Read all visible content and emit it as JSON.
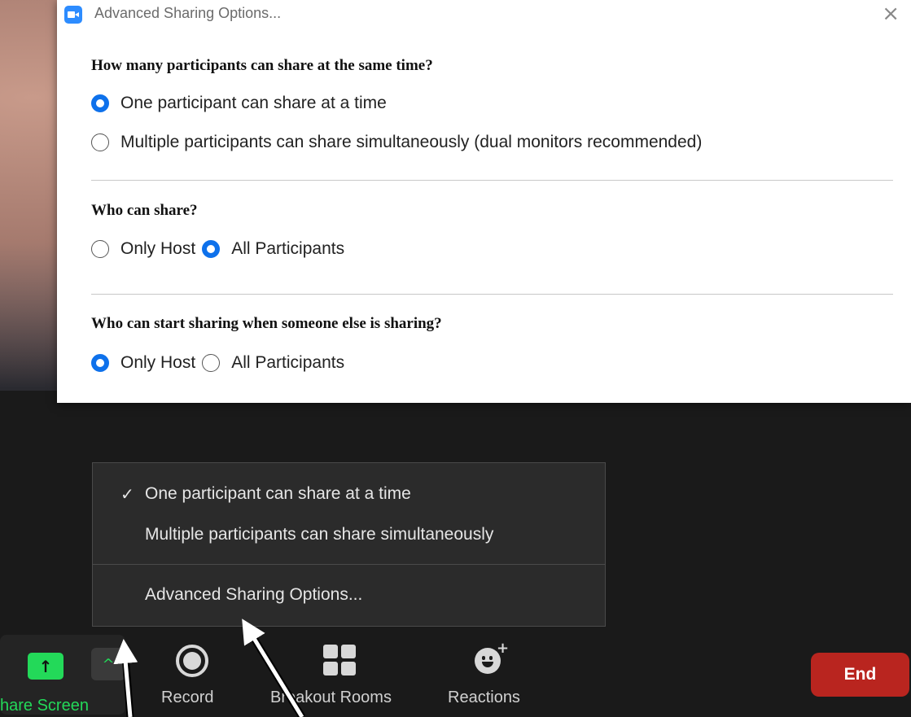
{
  "dialog": {
    "title": "Advanced Sharing Options...",
    "close": "×",
    "section1": {
      "heading": "How many participants can share at the same time?",
      "options": [
        {
          "label": "One participant can share at a time",
          "selected": true
        },
        {
          "label": "Multiple participants can share simultaneously (dual monitors recommended)",
          "selected": false
        }
      ]
    },
    "section2": {
      "heading": "Who can share?",
      "options": [
        {
          "label": "Only Host",
          "selected": false
        },
        {
          "label": "All Participants",
          "selected": true
        }
      ]
    },
    "section3": {
      "heading": "Who can start sharing when someone else is sharing?",
      "options": [
        {
          "label": "Only Host",
          "selected": true
        },
        {
          "label": "All Participants",
          "selected": false
        }
      ]
    }
  },
  "menu": {
    "items": [
      {
        "label": "One participant can share at a time",
        "checked": true
      },
      {
        "label": "Multiple participants can share simultaneously",
        "checked": false
      }
    ],
    "check_glyph": "✓",
    "advanced": "Advanced Sharing Options..."
  },
  "toolbar": {
    "share_label": "hare Screen",
    "share_icon": "↑",
    "caret": "^",
    "record_label": "Record",
    "breakout_label": "Breakout Rooms",
    "reactions_label": "Reactions",
    "reactions_plus": "+",
    "end_label": "End"
  },
  "colors": {
    "accent_blue": "#0e71eb",
    "share_green": "#23d959",
    "end_red": "#b9251f"
  }
}
